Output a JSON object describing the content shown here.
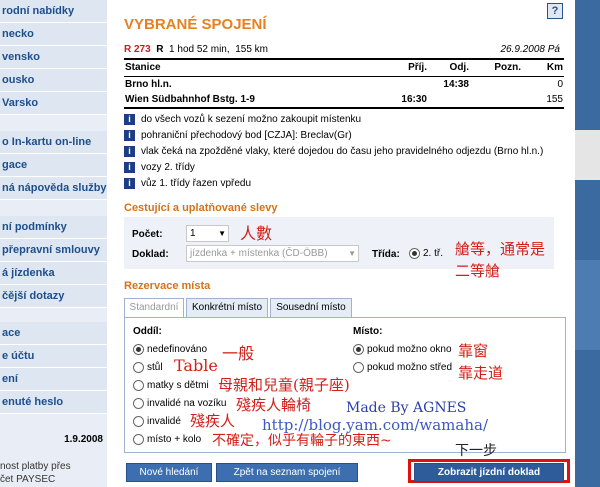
{
  "sidebar": {
    "group1": [
      "rodní nabídky",
      "necko",
      "vensko",
      "ousko",
      "Varsko"
    ],
    "group2": [
      "o In-kartu on-line",
      "gace",
      "ná nápověda služby"
    ],
    "group3": [
      "ní podmínky",
      "přepravní smlouvy",
      "á jízdenka",
      "čější dotazy"
    ],
    "group4": [
      "ace",
      "e účtu",
      "ení",
      "enuté heslo"
    ],
    "date": "1.9.2008",
    "note1": "nost platby přes",
    "note2": "čet PAYSEC"
  },
  "main": {
    "title": "VYBRANÉ SPOJENÍ",
    "help_glyph": "?",
    "train": {
      "code": "R 273",
      "type": "R",
      "duration": "1 hod 52 min,",
      "distance": "155 km",
      "date": "26.9.2008 Pá"
    },
    "route_headers": [
      "Stanice",
      "Příj.",
      "Odj.",
      "Pozn.",
      "Km"
    ],
    "route_rows": [
      [
        "Brno hl.n.",
        "",
        "14:38",
        "",
        "0"
      ],
      [
        "Wien Südbahnhof Bstg. 1-9",
        "16:30",
        "",
        "",
        "155"
      ]
    ],
    "info_letter": "i",
    "notes": [
      "do všech vozů k sezení možno zakoupit místenku",
      "pohraniční přechodový bod [CZJA]: Breclav(Gr)",
      "vlak čeká na zpožděné vlaky, které dojedou do času jeho pravidelného odjezdu (Brno hl.n.)",
      "vozy 2. třídy",
      "vůz 1. třídy řazen vpředu"
    ],
    "section_passengers": "Cestující a uplatňované slevy",
    "count_label": "Počet:",
    "count_value": "1",
    "discount_label": "Doklad:",
    "discount_value": "jízdenka + místenka (ČD-ÖBB)",
    "class_label": "Třída:",
    "class_value": "2. tř.",
    "section_reservation": "Rezervace místa",
    "tabs": [
      "Standardní",
      "Konkrétní místo",
      "Sousední místo"
    ],
    "section_label": "Oddíl:",
    "section_options": [
      "nedefinováno",
      "stůl",
      "matky s dětmi",
      "invalidé na vozíku",
      "invalidé",
      "místo + kolo"
    ],
    "place_label": "Místo:",
    "place_options": [
      "pokud možno okno",
      "pokud možno střed"
    ],
    "buttons": {
      "new_search": "Nové hledání",
      "back": "Zpět na seznam spojení",
      "show": "Zobrazit jízdní doklad"
    }
  },
  "annotations": {
    "count": "人數",
    "class": "艙等，通常是",
    "class2": "二等艙",
    "general": "一般",
    "table": "Table",
    "mother": "母親和兒童(親子座)",
    "wheelchair": "殘疾人輪椅",
    "disabled": "殘疾人",
    "bike": "不確定，似乎有輪子的東西~",
    "window": "靠窗",
    "aisle": "靠走道",
    "madeby": "Made By AGNES",
    "url": "http://blog.yam.com/wamaha/",
    "next": "下一步"
  },
  "colors": {
    "accent": "#e8801f",
    "link": "#1d4f8c",
    "button": "#3d6fb0",
    "highlight": "#e01010",
    "annotation": "#d1201a"
  }
}
